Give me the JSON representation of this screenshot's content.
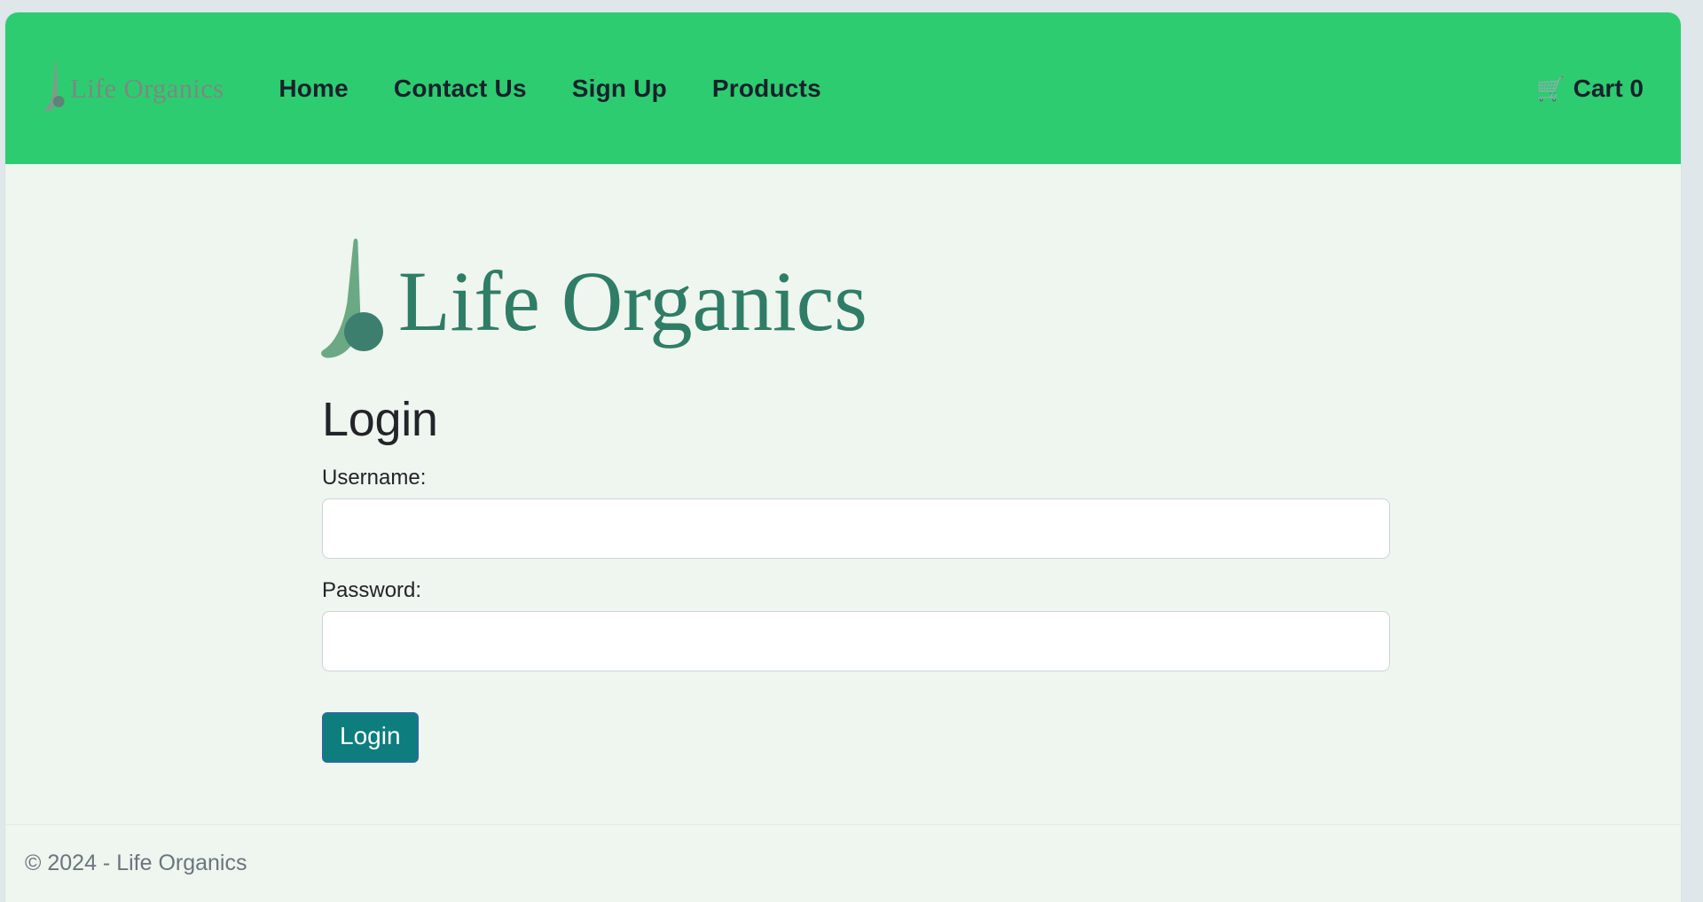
{
  "brand": {
    "name": "Life Organics",
    "logo_icon": "leaf-drop-logo",
    "leaf_color": "#6aa984",
    "dot_color": "#3d7f6f",
    "wordmark_color": "#2f7d66"
  },
  "navbar": {
    "background_color": "#2ECC71",
    "brand_label": "Life Organics",
    "links": [
      {
        "label": "Home",
        "name": "nav-link-home"
      },
      {
        "label": "Contact Us",
        "name": "nav-link-contact-us"
      },
      {
        "label": "Sign Up",
        "name": "nav-link-sign-up"
      },
      {
        "label": "Products",
        "name": "nav-link-products"
      }
    ],
    "cart": {
      "icon": "shopping-cart-icon",
      "glyph": "🛒",
      "label": "Cart 0",
      "count": 0
    }
  },
  "main": {
    "hero_wordmark": "Life Organics",
    "title": "Login",
    "form": {
      "username": {
        "label": "Username:",
        "value": "",
        "placeholder": ""
      },
      "password": {
        "label": "Password:",
        "value": "",
        "placeholder": ""
      },
      "submit_label": "Login"
    }
  },
  "footer": {
    "copyright": "© 2024 - Life Organics"
  },
  "theme": {
    "page_background": "#EFF5EF",
    "navbar_green": "#2ECC71",
    "button_teal": "#0D7D7D",
    "button_border": "#2A6B9C",
    "input_border": "#CED4DA",
    "muted_text": "#6C757D"
  }
}
